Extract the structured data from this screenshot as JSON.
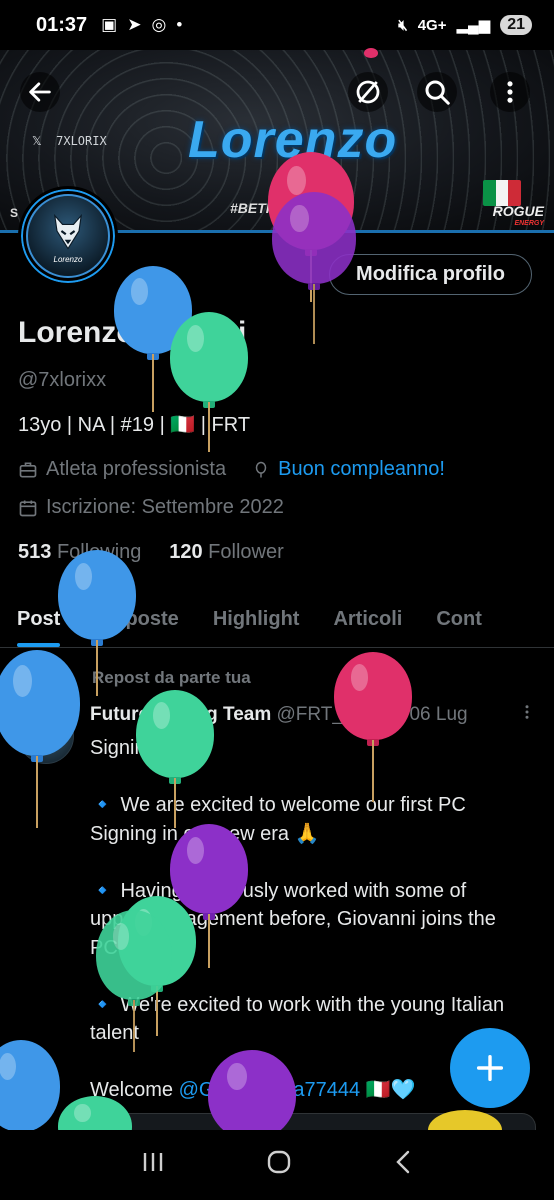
{
  "status_bar": {
    "time": "01:37",
    "network": "4G+",
    "battery": "21"
  },
  "banner": {
    "title": "Lorenzo",
    "x_handle": "7XLORIX",
    "hashtag": "#BETHE...",
    "sponsor": "ROGUE",
    "sponsor_sub": "ENERGY",
    "left_mark": "S"
  },
  "profile": {
    "edit_button": "Modifica profilo",
    "name": "Lorenzo Ferrieri",
    "handle": "@7xlorixx",
    "bio": "13yo | NA | #19 | 🇮🇹 | FRT",
    "category": "Atleta professionista",
    "birthday": "Buon compleanno!",
    "joined": "Iscrizione: Settembre 2022",
    "following_count": "513",
    "following_label": "Following",
    "followers_count": "120",
    "followers_label": "Follower"
  },
  "tabs": [
    "Post",
    "Risposte",
    "Highlight",
    "Articoli",
    "Cont"
  ],
  "post": {
    "repost_label": "Repost da parte tua",
    "author": "Future Racing Team",
    "author_handle": "@FRT_Rac...",
    "date": "· 06 Lug",
    "line1": "Signing",
    "para1": "We are excited to welcome our first PC Signing in our new era 🙏",
    "para2": "Having previously worked with some of upper management before, Giovanni joins the PC Team",
    "para3": "We're excited to work with the young Italian talent",
    "welcome": "Welcome",
    "mention": "@GiovanniGa77444",
    "welcome_tail": "🇮🇹🩵"
  },
  "colors": {
    "accent": "#1d9bf0",
    "muted": "#71767b",
    "text": "#e7e9ea"
  },
  "icons": {
    "back": "back-arrow-icon",
    "search": "search-icon",
    "more": "more-vertical-icon",
    "compose": "plus-icon"
  }
}
